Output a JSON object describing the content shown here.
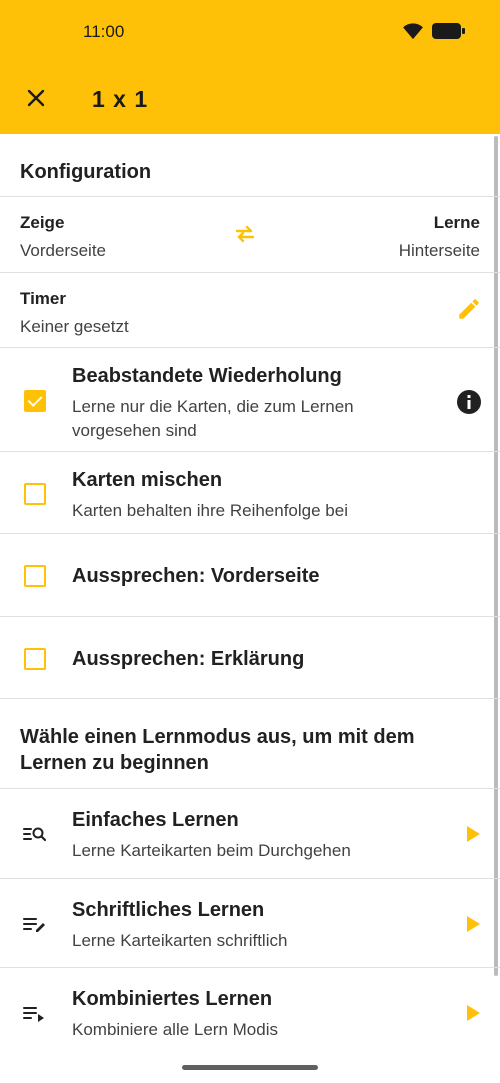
{
  "status_bar": {
    "time": "11:00"
  },
  "app_bar": {
    "title": "1 x 1"
  },
  "config": {
    "heading": "Konfiguration",
    "show_label": "Zeige",
    "show_value": "Vorderseite",
    "learn_label": "Lerne",
    "learn_value": "Hinterseite",
    "timer_label": "Timer",
    "timer_value": "Keiner gesetzt"
  },
  "options": [
    {
      "title": "Beabstandete Wiederholung",
      "subtitle": "Lerne nur die Karten, die zum Lernen vorgesehen sind",
      "checked": true
    },
    {
      "title": "Karten mischen",
      "subtitle": "Karten behalten ihre Reihenfolge bei",
      "checked": false
    },
    {
      "title": "Aussprechen: Vorderseite",
      "checked": false
    },
    {
      "title": "Aussprechen: Erklärung",
      "checked": false
    }
  ],
  "modes": {
    "heading": "Wähle einen Lernmodus aus, um mit dem Lernen zu beginnen",
    "items": [
      {
        "title": "Einfaches Lernen",
        "subtitle": "Lerne Karteikarten beim Durchgehen",
        "icon": "list-search-icon"
      },
      {
        "title": "Schriftliches Lernen",
        "subtitle": "Lerne Karteikarten schriftlich",
        "icon": "list-edit-icon"
      },
      {
        "title": "Kombiniertes Lernen",
        "subtitle": "Kombiniere alle Lern Modis",
        "icon": "list-play-icon"
      }
    ]
  },
  "colors": {
    "accent": "#FFC107",
    "text": "#212121",
    "divider": "#e0e0e0"
  }
}
